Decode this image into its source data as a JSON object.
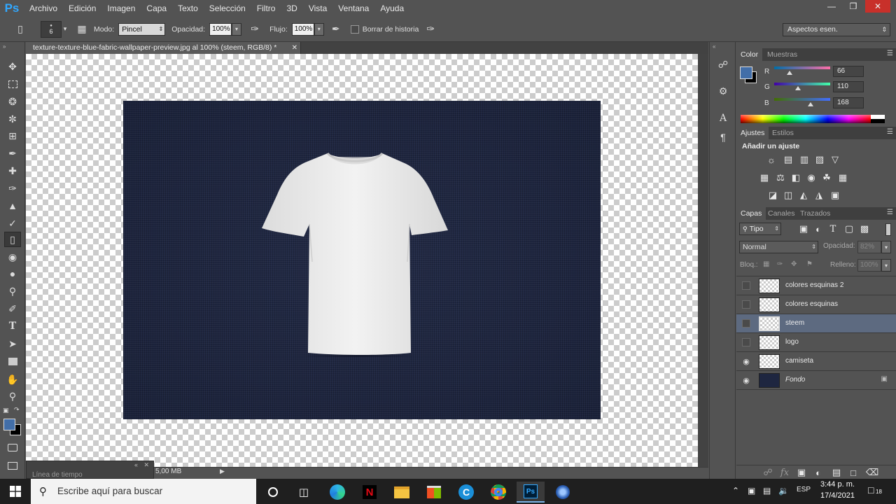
{
  "app": {
    "logo": "Ps"
  },
  "menu": [
    "Archivo",
    "Edición",
    "Imagen",
    "Capa",
    "Texto",
    "Selección",
    "Filtro",
    "3D",
    "Vista",
    "Ventana",
    "Ayuda"
  ],
  "options": {
    "brush_size": "6",
    "mode_label": "Modo:",
    "mode_value": "Pincel",
    "opacity_label": "Opacidad:",
    "opacity_value": "100%",
    "flow_label": "Flujo:",
    "flow_value": "100%",
    "erase_history_label": "Borrar de historia",
    "workspace": "Aspectos esen."
  },
  "document": {
    "tab_title": "texture-texture-blue-fabric-wallpaper-preview.jpg al 100% (steem, RGB/8) *",
    "file_size": "5,00 MB",
    "timeline_label": "Línea de tiempo"
  },
  "color_panel": {
    "tabs": [
      "Color",
      "Muestras"
    ],
    "r_label": "R",
    "g_label": "G",
    "b_label": "B",
    "r": "66",
    "g": "110",
    "b": "168",
    "foreground": "#426ea8",
    "background": "#000000"
  },
  "adjustments_panel": {
    "tabs": [
      "Ajustes",
      "Estilos"
    ],
    "heading": "Añadir un ajuste"
  },
  "layers_panel": {
    "tabs": [
      "Capas",
      "Canales",
      "Trazados"
    ],
    "filter_kind": "Tipo",
    "blend_mode": "Normal",
    "opacity_label": "Opacidad:",
    "opacity_value": "82%",
    "lock_label": "Bloq.:",
    "fill_label": "Relleno:",
    "fill_value": "100%",
    "layers": [
      {
        "name": "colores esquinas 2",
        "visible": false
      },
      {
        "name": "colores esquinas",
        "visible": false
      },
      {
        "name": "steem",
        "visible": false,
        "selected": true
      },
      {
        "name": "logo",
        "visible": false
      },
      {
        "name": "camiseta",
        "visible": true
      },
      {
        "name": "Fondo",
        "visible": true,
        "locked": true
      }
    ]
  },
  "taskbar": {
    "search_placeholder": "Escribe aquí para buscar",
    "lang": "ESP",
    "time": "3:44 p. m.",
    "date": "17/4/2021",
    "notifications": "18"
  }
}
